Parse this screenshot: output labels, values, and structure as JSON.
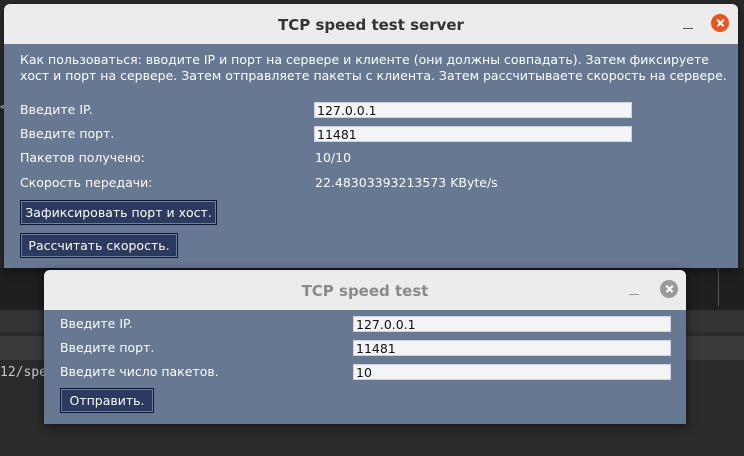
{
  "background": {
    "code_fragment": "12/spe",
    "left_fragment": "<"
  },
  "server_window": {
    "title": "TCP speed test server",
    "description": "Как пользоваться: вводите IP и порт на сервере и клиенте (они должны совпадать). Затем фиксируете хост и порт на сервере. Затем отправляете пакеты с клиента. Затем рассчитываете скорость на сервере.",
    "ip_label": "Введите IP.",
    "ip_value": "127.0.0.1",
    "port_label": "Введите порт.",
    "port_value": "11481",
    "packets_label": "Пакетов получено:",
    "packets_value": "10/10",
    "speed_label": "Скорость передачи:",
    "speed_value": "22.48303393213573 KByte/s",
    "fix_button": "Зафиксировать порт и хост.",
    "calc_button": "Рассчитать скорость."
  },
  "client_window": {
    "title": "TCP speed test",
    "ip_label": "Введите IP.",
    "ip_value": "127.0.0.1",
    "port_label": "Введите порт.",
    "port_value": "11481",
    "count_label": "Введите число пакетов.",
    "count_value": "10",
    "send_button": "Отправить."
  },
  "colors": {
    "window_bg": "#667892",
    "button_bg": "#2b3a5e",
    "close_active": "#e95420",
    "close_inactive": "#9a9a9a"
  }
}
